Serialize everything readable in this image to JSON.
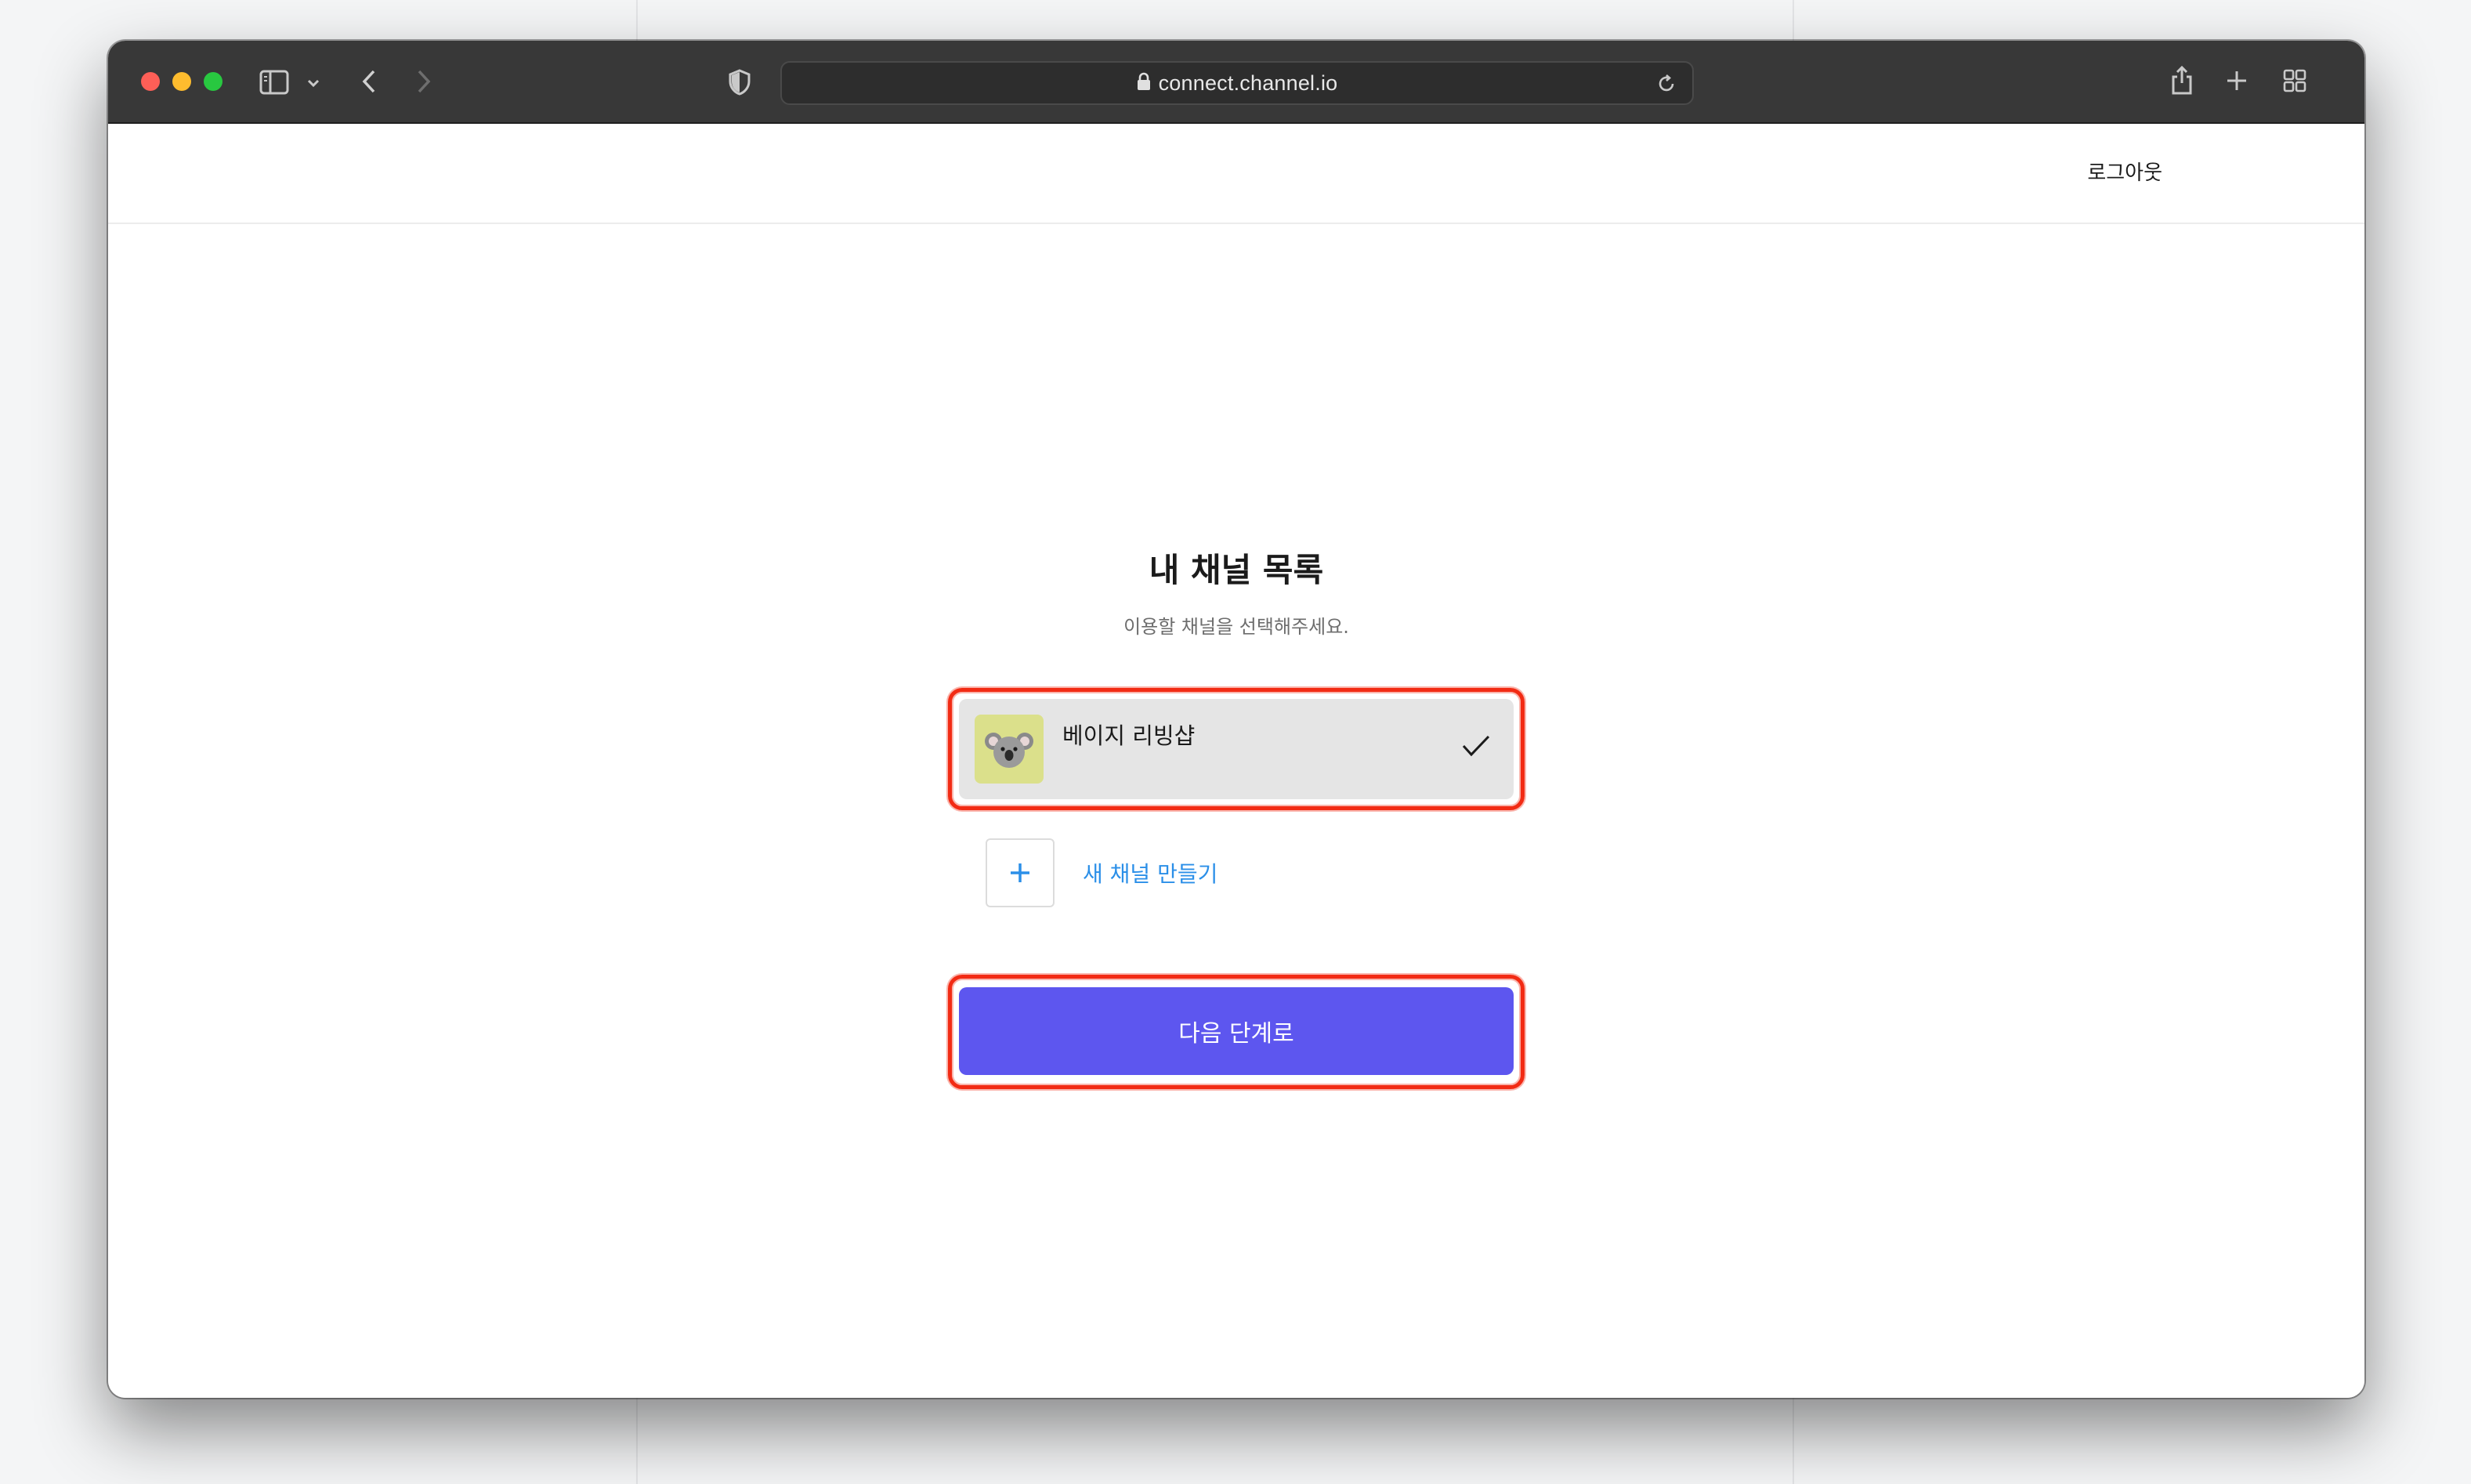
{
  "browser": {
    "url": "connect.channel.io"
  },
  "header": {
    "logout_label": "로그아웃"
  },
  "main": {
    "title": "내 채널 목록",
    "subtitle": "이용할 채널을 선택해주세요.",
    "channels": [
      {
        "name": "베이지 리빙샵",
        "selected": true,
        "avatar": "koala-emoji"
      }
    ],
    "new_channel_label": "새 채널 만들기",
    "next_button_label": "다음 단계로"
  },
  "colors": {
    "primary_button": "#5d56ef",
    "link": "#2b8fe8",
    "highlight": "#f22b14",
    "selected_card": "#e5e5e5"
  }
}
